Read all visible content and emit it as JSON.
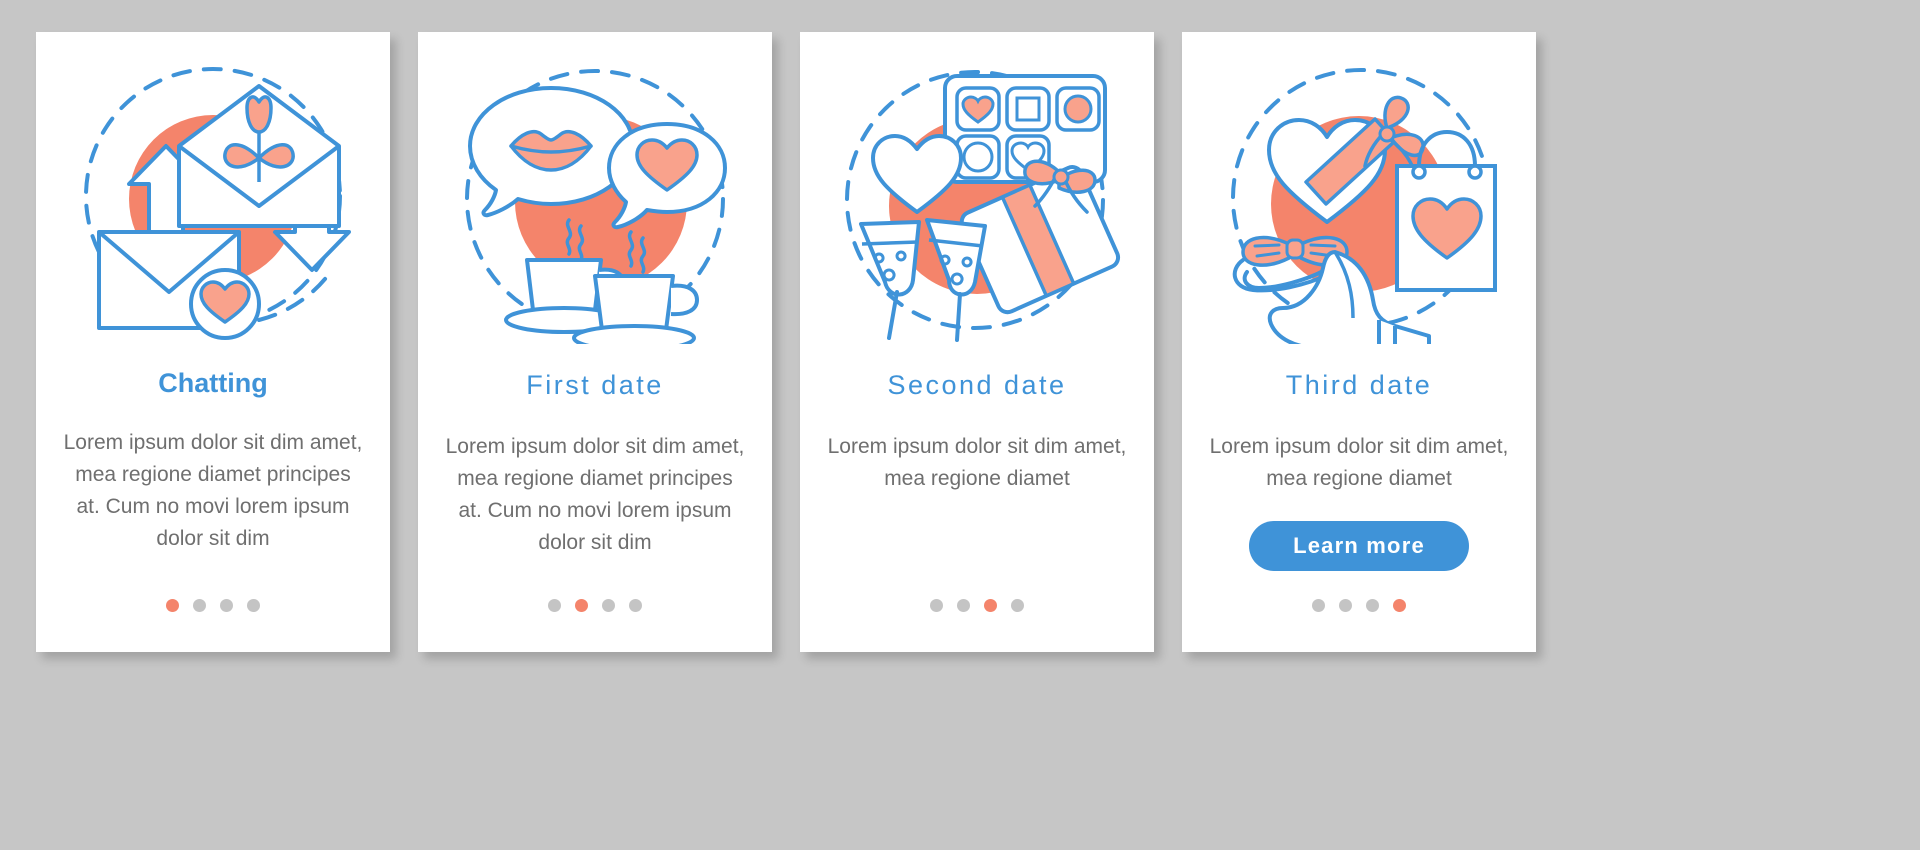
{
  "background_color": "#c6c6c6",
  "theme": {
    "blue": "#3f93d8",
    "coral": "#f4846b",
    "coral_light": "#f9a28c",
    "dot_inactive": "#c4c4c4",
    "body_text": "#6f6f6f",
    "card_bg": "#ffffff"
  },
  "cards": [
    {
      "title": "Chatting",
      "title_style": "bold",
      "body": "Lorem ipsum dolor sit dim amet, mea regione diamet principes at. Cum no movi lorem ipsum dolor sit dim",
      "illustration": "envelopes-tulip-arrows-heart",
      "dots": {
        "count": 4,
        "active_index": 0
      },
      "button": null
    },
    {
      "title": "First date",
      "title_style": "light",
      "body": "Lorem ipsum dolor sit dim amet, mea regione diamet principes at. Cum no movi lorem ipsum dolor sit dim",
      "illustration": "speech-bubbles-lips-heart-coffee-cups",
      "dots": {
        "count": 4,
        "active_index": 1
      },
      "button": null
    },
    {
      "title": "Second date",
      "title_style": "light",
      "body": "Lorem ipsum dolor sit dim amet, mea regione diamet",
      "illustration": "chocolate-box-gift-champagne-heart",
      "dots": {
        "count": 4,
        "active_index": 2
      },
      "button": null
    },
    {
      "title": "Third date",
      "title_style": "light",
      "body": "Lorem ipsum dolor sit dim amet, mea regione diamet",
      "illustration": "heart-gift-shopping-bag-high-heel-bow",
      "dots": {
        "count": 4,
        "active_index": 3
      },
      "button": {
        "label": "Learn more"
      }
    }
  ]
}
